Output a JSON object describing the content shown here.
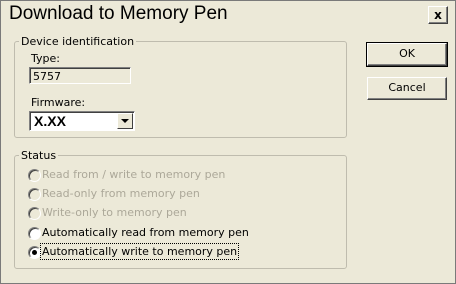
{
  "dialog": {
    "title": "Download to Memory Pen",
    "close_glyph": "x",
    "close_icon": "close-icon"
  },
  "device": {
    "legend": "Device identification",
    "type_label": "Type:",
    "type_value": "5757",
    "firmware_label": "Firmware:",
    "firmware_value": "X.XX",
    "dropdown_icon": "chevron-down-icon"
  },
  "buttons": {
    "ok": "OK",
    "cancel": "Cancel"
  },
  "status": {
    "legend": "Status",
    "options": [
      {
        "label": "Read from / write to memory pen",
        "enabled": false,
        "selected": false
      },
      {
        "label": "Read-only from memory pen",
        "enabled": false,
        "selected": false
      },
      {
        "label": "Write-only to memory pen",
        "enabled": false,
        "selected": false
      },
      {
        "label": "Automatically read from memory pen",
        "enabled": true,
        "selected": false
      },
      {
        "label": "Automatically write to memory pen",
        "enabled": true,
        "selected": true
      }
    ]
  },
  "colors": {
    "dialog_bg": "#ece9d8",
    "disabled_text": "#aca899",
    "group_border": "#bfbcae"
  }
}
